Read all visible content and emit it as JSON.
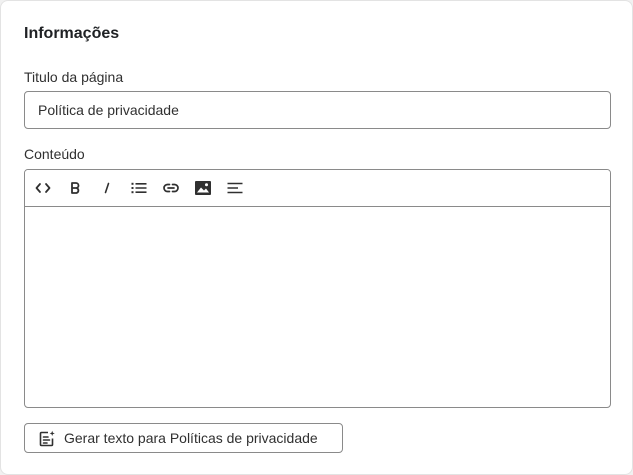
{
  "card": {
    "title": "Informações"
  },
  "title_field": {
    "label": "Titulo da página",
    "value": "Política de privacidade"
  },
  "content_field": {
    "label": "Conteúdo",
    "value": ""
  },
  "toolbar": {
    "items": [
      {
        "icon": "code-icon"
      },
      {
        "icon": "bold-icon"
      },
      {
        "icon": "italic-icon"
      },
      {
        "icon": "bulleted-list-icon"
      },
      {
        "icon": "link-icon"
      },
      {
        "icon": "image-icon"
      },
      {
        "icon": "align-left-icon"
      }
    ]
  },
  "generate_button": {
    "label": "Gerar texto para Políticas de privacidade",
    "icon": "sparkle-document-icon"
  }
}
